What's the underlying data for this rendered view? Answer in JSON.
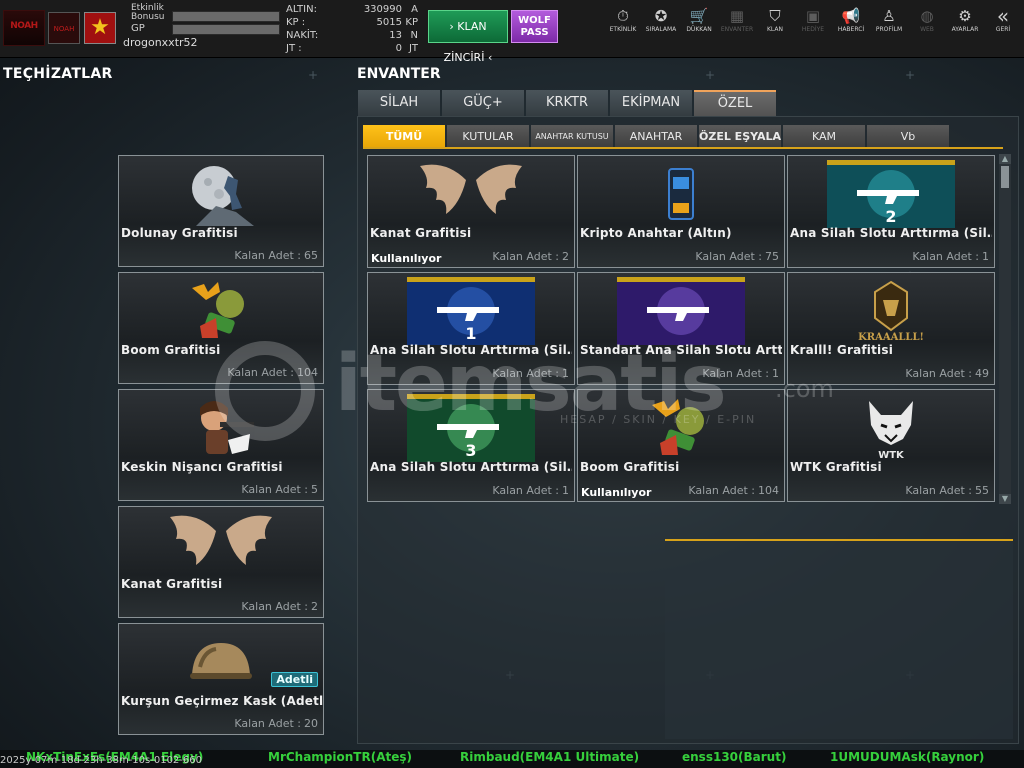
{
  "header": {
    "logo_text": "NOAH",
    "logo2_text": "NOAH",
    "rank_icon": "star-rank-icon",
    "etkinlik_bonusu_label": "Etkinlik Bonusu",
    "gp_label": "GP",
    "username": "drogonxxtr52",
    "currency": [
      {
        "label": "ALTIN:",
        "value": "330990",
        "unit": "A"
      },
      {
        "label": "KP :",
        "value": "5015",
        "unit": "KP"
      },
      {
        "label": "NAKİT:",
        "value": "13",
        "unit": "N"
      },
      {
        "label": "JT :",
        "value": "0",
        "unit": "JT"
      }
    ],
    "klan_zinciri_label": "KLAN ZİNCİRİ",
    "wolf_pass_label": "WOLF PASS",
    "nav": [
      {
        "label": "ETKİNLİK",
        "icon": "stopwatch-icon"
      },
      {
        "label": "SIRALAMA",
        "icon": "medal-icon"
      },
      {
        "label": "DÜKKAN",
        "icon": "cart-icon"
      },
      {
        "label": "ENVANTER",
        "icon": "inventory-icon"
      },
      {
        "label": "KLAN",
        "icon": "shield-icon"
      },
      {
        "label": "HEDİYE",
        "icon": "gift-icon"
      },
      {
        "label": "HABERCİ",
        "icon": "megaphone-icon"
      },
      {
        "label": "PROFİLM",
        "icon": "profile-icon"
      },
      {
        "label": "WEB",
        "icon": "globe-icon"
      },
      {
        "label": "AYARLAR",
        "icon": "gear-icon"
      },
      {
        "label": "GERİ",
        "icon": "back-icon"
      }
    ]
  },
  "left": {
    "title": "TEÇHİZATLAR",
    "count_label": "Kalan Adet :",
    "items": [
      {
        "name": "Dolunay Grafitisi",
        "count": "65",
        "badge": "",
        "status": ""
      },
      {
        "name": "Boom Grafitisi",
        "count": "104",
        "badge": "",
        "status": ""
      },
      {
        "name": "Keskin Nişancı Grafitisi",
        "count": "5",
        "badge": "",
        "status": ""
      },
      {
        "name": "Kanat Grafitisi",
        "count": "2",
        "badge": "",
        "status": ""
      },
      {
        "name": "Kurşun Geçirmez Kask (Adetli)",
        "count": "20",
        "badge": "Adetli",
        "status": ""
      }
    ]
  },
  "inventory": {
    "title": "ENVANTER",
    "tabs": [
      "SİLAH",
      "GÜÇ+",
      "KRKTR",
      "EKİPMAN",
      "ÖZEL"
    ],
    "subtabs": [
      "TÜMÜ",
      "KUTULAR",
      "ANAHTAR KUTUSU",
      "ANAHTAR",
      "ÖZEL EŞYALAR",
      "KAM",
      "Vb"
    ],
    "count_label": "Kalan Adet :",
    "items": [
      {
        "name": "Kanat Grafitisi",
        "count": "2",
        "status": "Kullanılıyor",
        "slot": ""
      },
      {
        "name": "Kripto Anahtar (Altın)",
        "count": "75",
        "status": "",
        "slot": ""
      },
      {
        "name": "Ana Silah Slotu Arttırma (Sil…",
        "count": "1",
        "status": "",
        "slot": "2"
      },
      {
        "name": "Ana Silah Slotu Arttırma (Sil…",
        "count": "1",
        "status": "",
        "slot": "1"
      },
      {
        "name": "Standart Ana Silah Slotu Artt…",
        "count": "1",
        "status": "",
        "slot": ""
      },
      {
        "name": "Kralll! Grafitisi",
        "count": "49",
        "status": "",
        "slot": ""
      },
      {
        "name": "Ana Silah Slotu Arttırma (Sil…",
        "count": "1",
        "status": "",
        "slot": "3"
      },
      {
        "name": "Boom Grafitisi",
        "count": "104",
        "status": "Kullanılıyor",
        "slot": ""
      },
      {
        "name": "WTK Grafitisi",
        "count": "55",
        "status": "",
        "slot": ""
      }
    ],
    "badge_kraalll": "KRAAALLL!",
    "badge_wtk": "WTK"
  },
  "watermark": {
    "text": "itemsatis",
    "sub": "HESAP / SKIN / KEY / E-PIN",
    "com": ".com"
  },
  "bottom": {
    "players": [
      "NKxTinExEs(EM4A1 Elegy)",
      "MrChampionTR(Ateş)",
      "Rimbaud(EM4A1 Ultimate)",
      "enss130(Barut)",
      "1UMUDUMAsk(Raynor)"
    ],
    "timestamp": "2025y-07m-18d-23h-38m-10s-0102-660"
  }
}
